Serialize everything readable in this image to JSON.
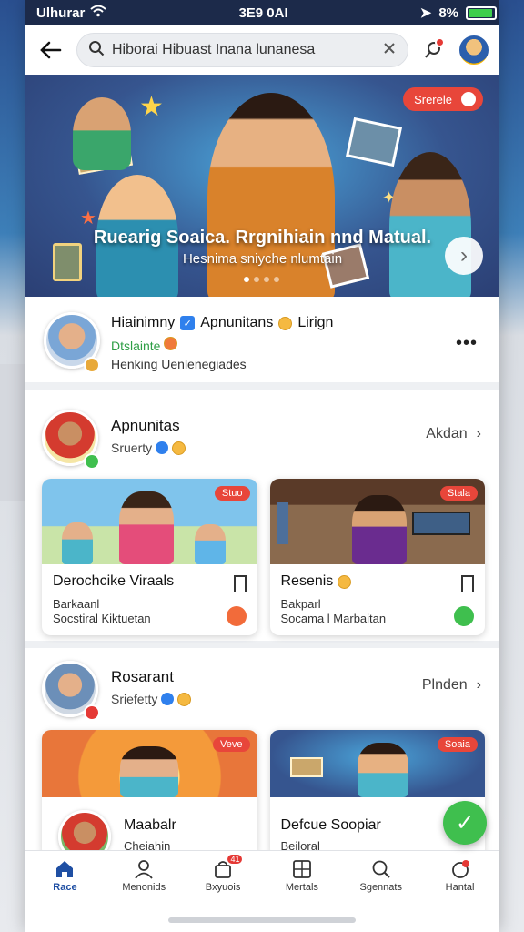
{
  "status_bar": {
    "carrier": "Ulhurar",
    "time": "3E9 0AI",
    "battery": "8%"
  },
  "search": {
    "value": "Hiborai Hibuast Inana lunanesa"
  },
  "hero": {
    "badge": "Srerele",
    "title": "Ruearig Soaica. Rrgnihiain nnd Matual.",
    "subtitle": "Hesnima sniyche nlumtain",
    "dots": 4
  },
  "profile": {
    "name": "Hiainimny",
    "name_suffix": "Apnunitans",
    "name_tail": "Lirign",
    "status": "Dtslainte",
    "description": "Henking Uenlenegiades"
  },
  "section1": {
    "title": "Apnunitas",
    "subtitle": "Sruerty",
    "action": "Akdan",
    "cards": [
      {
        "tag": "Stuo",
        "title": "Derochcike Viraals",
        "line1": "Barkaanl",
        "line2": "Socstiral  Kiktuetan",
        "dot_color": "#f26b3a"
      },
      {
        "tag": "Stala",
        "title": "Resenis",
        "line1": "Bakparl",
        "line2": "Socama l Marbaitan",
        "dot_color": "#3fbf4e"
      }
    ]
  },
  "section2": {
    "title": "Rosarant",
    "subtitle": "Sriefetty",
    "action": "Plnden",
    "cards": [
      {
        "tag": "Veve",
        "title": "Maabalr",
        "line1": "Cheiahin"
      },
      {
        "tag": "Soaia",
        "title": "Defcue Soopiar",
        "line1": "Beiloral"
      }
    ]
  },
  "nav": [
    {
      "label": "Race",
      "icon": "home-icon",
      "active": true
    },
    {
      "label": "Menonids",
      "icon": "person-icon"
    },
    {
      "label": "Bxyuois",
      "icon": "bag-icon",
      "badge": "41"
    },
    {
      "label": "Mertals",
      "icon": "grid-icon"
    },
    {
      "label": "Sgennats",
      "icon": "search-icon"
    },
    {
      "label": "Hantal",
      "icon": "heart-icon"
    }
  ],
  "colors": {
    "accent": "#1f4fa3",
    "badge": "#e8463a",
    "green": "#3fbf4e"
  }
}
